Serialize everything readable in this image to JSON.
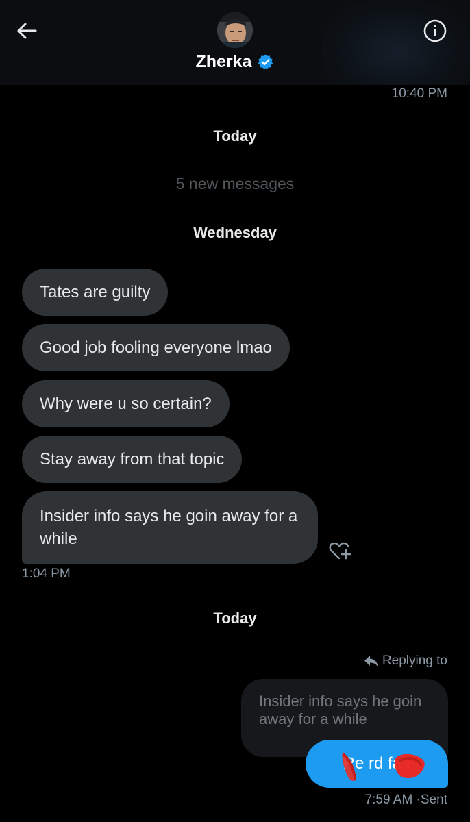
{
  "header": {
    "contact_name": "Zherka",
    "verified": true,
    "accent_color": "#1d9bf0",
    "icons": [
      "back-arrow-icon",
      "verified-badge-icon",
      "info-icon"
    ]
  },
  "top_timestamp": "10:40 PM",
  "separators": {
    "today_1": "Today",
    "new_messages": "5 new messages",
    "wednesday": "Wednesday",
    "today_2": "Today"
  },
  "incoming": [
    {
      "text": "Tates are guilty"
    },
    {
      "text": "Good job fooling everyone lmao"
    },
    {
      "text": "Why were u so certain?"
    },
    {
      "text": "Stay away from that topic"
    },
    {
      "text": "Insider info says he goin away for a while"
    }
  ],
  "incoming_time": "1:04 PM",
  "reply": {
    "label": "Replying to",
    "quoted_text": "Insider info says he goin away for a while"
  },
  "outgoing": {
    "text": "Re  rd fa   t",
    "time": "7:59 AM",
    "status": "·Sent"
  }
}
